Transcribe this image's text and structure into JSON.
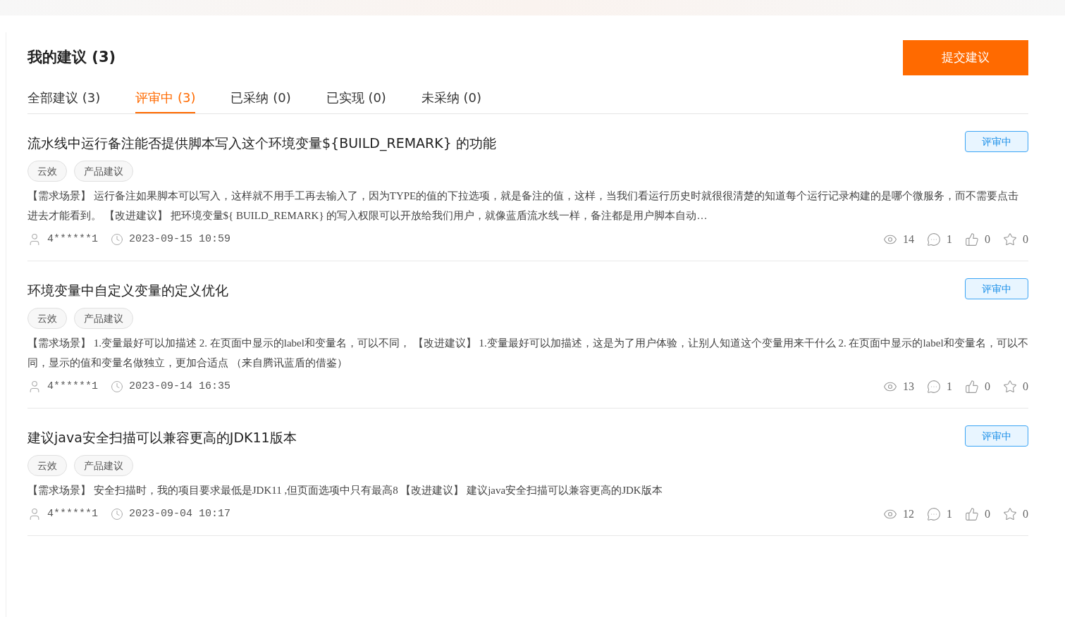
{
  "page": {
    "title": "我的建议 (3)",
    "submit_button": "提交建议"
  },
  "tabs": [
    {
      "label": "全部建议 (3)",
      "selected": false
    },
    {
      "label": "评审中 (3)",
      "selected": true
    },
    {
      "label": "已采纳 (0)",
      "selected": false
    },
    {
      "label": "已实现 (0)",
      "selected": false
    },
    {
      "label": "未采纳 (0)",
      "selected": false
    }
  ],
  "suggestions": [
    {
      "title": "流水线中运行备注能否提供脚本写入这个环境变量${BUILD_REMARK} 的功能",
      "status": "评审中",
      "tags": [
        "云效",
        "产品建议"
      ],
      "description": "【需求场景】 运行备注如果脚本可以写入，这样就不用手工再去输入了，因为TYPE的值的下拉选项，就是备注的值，这样，当我们看运行历史时就很很清楚的知道每个运行记录构建的是哪个微服务，而不需要点击进去才能看到。 【改进建议】 把环境变量${ BUILD_REMARK} 的写入权限可以开放给我们用户，就像蓝盾流水线一样，备注都是用户脚本自动…",
      "author": "4******1",
      "time": "2023-09-15 10:59",
      "views": "14",
      "comments": "1",
      "likes": "0",
      "favorites": "0"
    },
    {
      "title": "环境变量中自定义变量的定义优化",
      "status": "评审中",
      "tags": [
        "云效",
        "产品建议"
      ],
      "description": "【需求场景】 1.变量最好可以加描述 2. 在页面中显示的label和变量名，可以不同， 【改进建议】 1.变量最好可以加描述，这是为了用户体验，让别人知道这个变量用来干什么 2. 在页面中显示的label和变量名，可以不同，显示的值和变量名做独立，更加合适点 （来自腾讯蓝盾的借鉴）",
      "author": "4******1",
      "time": "2023-09-14 16:35",
      "views": "13",
      "comments": "1",
      "likes": "0",
      "favorites": "0"
    },
    {
      "title": "建议java安全扫描可以兼容更高的JDK11版本",
      "status": "评审中",
      "tags": [
        "云效",
        "产品建议"
      ],
      "description": "【需求场景】 安全扫描时，我的项目要求最低是JDK11 ,但页面选项中只有最高8 【改进建议】 建议java安全扫描可以兼容更高的JDK版本",
      "author": "4******1",
      "time": "2023-09-04 10:17",
      "views": "12",
      "comments": "1",
      "likes": "0",
      "favorites": "0"
    }
  ]
}
